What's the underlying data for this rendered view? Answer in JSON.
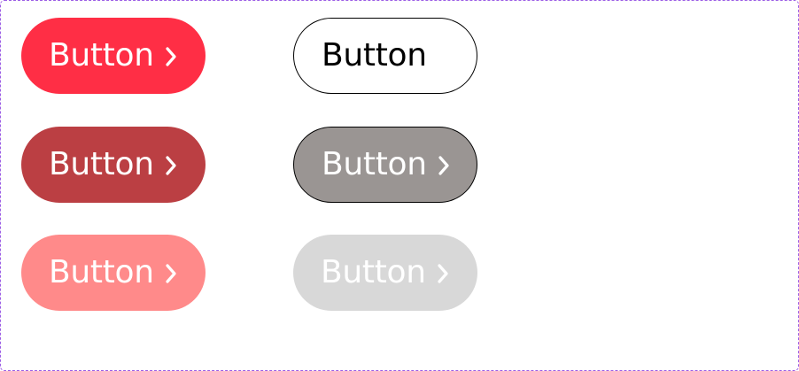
{
  "colors": {
    "frame_border": "#9b5de5",
    "primary_default": "#ff2e45",
    "primary_pressed": "#bb3f43",
    "primary_disabled": "#ff8a8a",
    "secondary_default_bg": "#ffffff",
    "secondary_pressed_bg": "#9a9593",
    "secondary_disabled_bg": "#d8d8d8"
  },
  "buttons": {
    "primary_default": {
      "label": "Button",
      "icon": "chevron-right-icon"
    },
    "primary_pressed": {
      "label": "Button",
      "icon": "chevron-right-icon"
    },
    "primary_disabled": {
      "label": "Button",
      "icon": "chevron-right-icon"
    },
    "secondary_default": {
      "label": "Button"
    },
    "secondary_pressed": {
      "label": "Button",
      "icon": "chevron-right-icon"
    },
    "secondary_disabled": {
      "label": "Button",
      "icon": "chevron-right-icon"
    }
  }
}
